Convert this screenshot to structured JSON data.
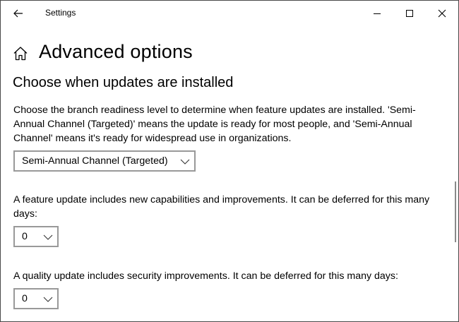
{
  "window": {
    "title": "Settings",
    "controls": {
      "minimize": "minimize-icon",
      "maximize": "maximize-icon",
      "close": "close-icon"
    }
  },
  "header": {
    "back_icon": "back-arrow-icon",
    "home_icon": "home-icon",
    "page_title": "Advanced options"
  },
  "section": {
    "title": "Choose when updates are installed",
    "branch_description": "Choose the branch readiness level to determine when feature updates are installed. 'Semi-Annual Channel (Targeted)' means the update is ready for most people, and 'Semi-Annual Channel' means it's ready for widespread use in organizations.",
    "branch_selected": "Semi-Annual Channel (Targeted)",
    "feature_description": "A feature update includes new capabilities and improvements. It can be deferred for this many days:",
    "feature_days": "0",
    "quality_description": "A quality update includes security improvements. It can be deferred for this many days:",
    "quality_days": "0"
  },
  "colors": {
    "border": "#999999",
    "window_border": "#4a4a4a",
    "scroll_thumb": "#8a8a8a"
  }
}
